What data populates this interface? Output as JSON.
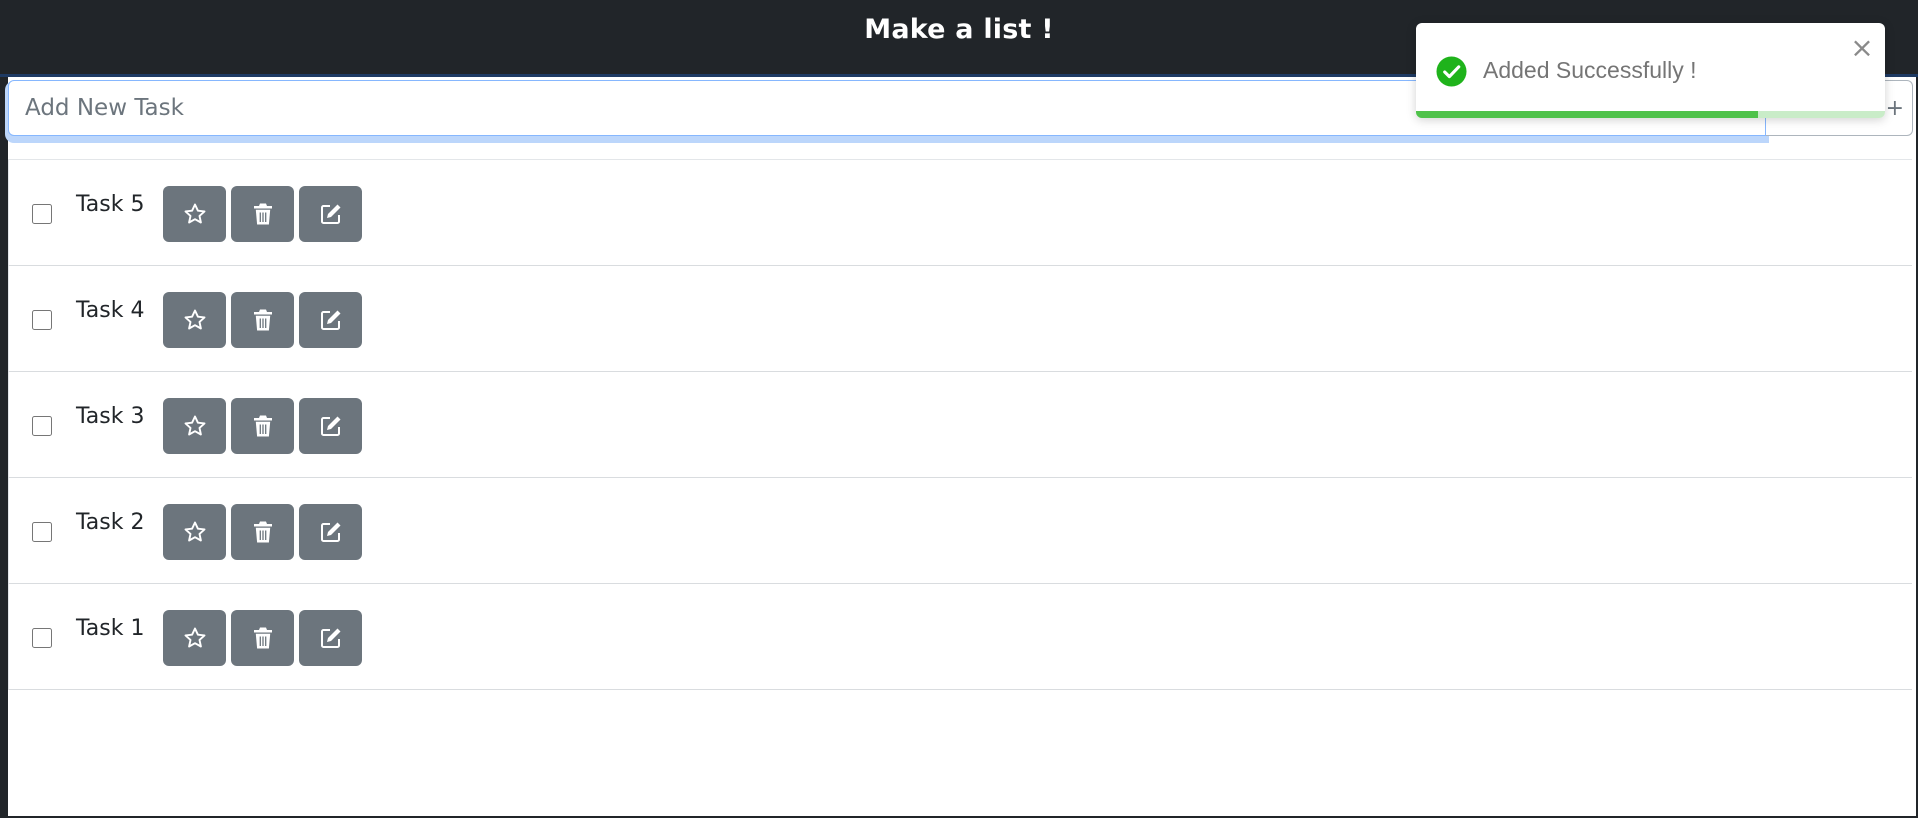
{
  "header": {
    "title": "Make a list !"
  },
  "input": {
    "placeholder": "Add New Task",
    "value": ""
  },
  "add_button": {
    "label": "+"
  },
  "tasks": [
    {
      "label": "Task 5",
      "checked": false
    },
    {
      "label": "Task 4",
      "checked": false
    },
    {
      "label": "Task 3",
      "checked": false
    },
    {
      "label": "Task 2",
      "checked": false
    },
    {
      "label": "Task 1",
      "checked": false
    }
  ],
  "task_actions": {
    "icons": [
      "star-icon",
      "trash-icon",
      "edit-icon"
    ]
  },
  "toast": {
    "message": "Added Successfully !",
    "icon": "check-circle-icon",
    "close_label": "×",
    "progress": 0.73
  },
  "colors": {
    "header_bg": "#212529",
    "action_button_bg": "#6c757d",
    "success_green": "#1fb31b",
    "progress_fill": "#4fc24a",
    "progress_track": "#c9ecc8",
    "input_focus": "#86b7fe"
  }
}
